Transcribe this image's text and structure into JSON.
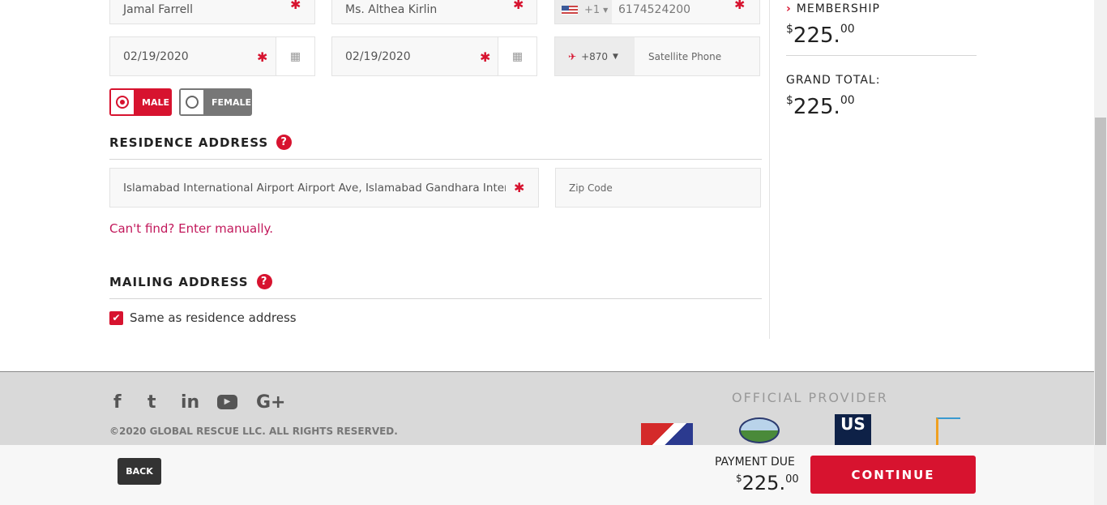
{
  "form": {
    "name1": "Jamal Farrell",
    "name2": "Ms. Althea Kirlin",
    "phone_code": "+1",
    "phone": "6174524200",
    "date1": "02/19/2020",
    "date2": "02/19/2020",
    "sat_code": "+870",
    "sat_placeholder": "Satellite Phone",
    "gender_male": "MALE",
    "gender_female": "FEMALE",
    "residence_heading": "RESIDENCE ADDRESS",
    "address": "Islamabad International Airport Airport Ave, Islamabad Gandhara Intern...",
    "zip_placeholder": "Zip Code",
    "manual_link": "Can't find? Enter manually.",
    "mailing_heading": "MAILING ADDRESS",
    "same_as_label": "Same as residence address",
    "help": "?",
    "required": "✱"
  },
  "summary": {
    "membership_label": "MEMBERSHIP",
    "membership_price": "225.",
    "membership_cents": "00",
    "currency": "$",
    "grand_total_label": "GRAND TOTAL:",
    "total_price": "225.",
    "total_cents": "00"
  },
  "footer": {
    "copyright": "©2020 GLOBAL RESCUE LLC. ALL RIGHTS RESERVED.",
    "official_provider": "OFFICIAL PROVIDER",
    "social": [
      "f",
      "t",
      "in",
      "▶",
      "G+"
    ],
    "us_logo": "US"
  },
  "bottom": {
    "back": "BACK",
    "payment_due": "PAYMENT DUE",
    "price": "225.",
    "cents": "00",
    "continue": "CONTINUE"
  },
  "colors": {
    "accent": "#d7132f"
  }
}
